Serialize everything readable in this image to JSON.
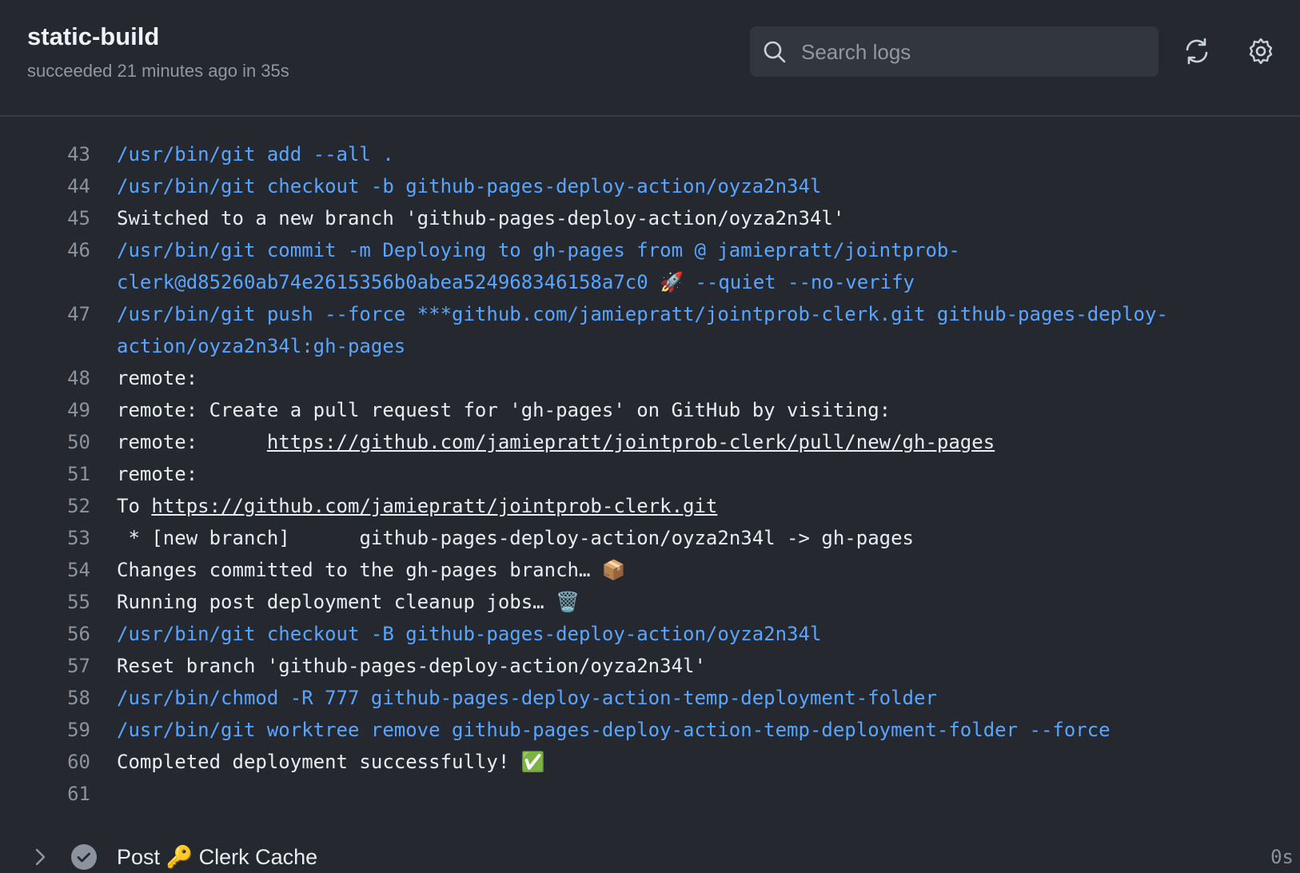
{
  "header": {
    "title": "static-build",
    "subtitle": "succeeded 21 minutes ago in 35s",
    "search_placeholder": "Search logs",
    "search_value": ""
  },
  "colors": {
    "background": "#25282e",
    "command": "#58a6ff",
    "text": "#e6edf3",
    "line_number": "#8b949e"
  },
  "log": [
    {
      "n": "43",
      "type": "cmd",
      "text": "/usr/bin/git add --all ."
    },
    {
      "n": "44",
      "type": "cmd",
      "text": "/usr/bin/git checkout -b github-pages-deploy-action/oyza2n34l"
    },
    {
      "n": "45",
      "type": "out",
      "text": "Switched to a new branch 'github-pages-deploy-action/oyza2n34l'"
    },
    {
      "n": "46",
      "type": "cmd",
      "text": "/usr/bin/git commit -m Deploying to gh-pages from @ jamiepratt/jointprob-clerk@d85260ab74e2615356b0abea524968346158a7c0 🚀 --quiet --no-verify"
    },
    {
      "n": "47",
      "type": "cmd",
      "text": "/usr/bin/git push --force ***github.com/jamiepratt/jointprob-clerk.git github-pages-deploy-action/oyza2n34l:gh-pages"
    },
    {
      "n": "48",
      "type": "out",
      "text": "remote: "
    },
    {
      "n": "49",
      "type": "out",
      "text": "remote: Create a pull request for 'gh-pages' on GitHub by visiting:        "
    },
    {
      "n": "50",
      "type": "out",
      "text": "remote:      ",
      "link": "https://github.com/jamiepratt/jointprob-clerk/pull/new/gh-pages"
    },
    {
      "n": "51",
      "type": "out",
      "text": "remote: "
    },
    {
      "n": "52",
      "type": "out",
      "text": "To ",
      "link": "https://github.com/jamiepratt/jointprob-clerk.git"
    },
    {
      "n": "53",
      "type": "out",
      "text": " * [new branch]      github-pages-deploy-action/oyza2n34l -> gh-pages"
    },
    {
      "n": "54",
      "type": "out",
      "text": "Changes committed to the gh-pages branch… 📦"
    },
    {
      "n": "55",
      "type": "out",
      "text": "Running post deployment cleanup jobs… 🗑️"
    },
    {
      "n": "56",
      "type": "cmd",
      "text": "/usr/bin/git checkout -B github-pages-deploy-action/oyza2n34l"
    },
    {
      "n": "57",
      "type": "out",
      "text": "Reset branch 'github-pages-deploy-action/oyza2n34l'"
    },
    {
      "n": "58",
      "type": "cmd",
      "text": "/usr/bin/chmod -R 777 github-pages-deploy-action-temp-deployment-folder"
    },
    {
      "n": "59",
      "type": "cmd",
      "text": "/usr/bin/git worktree remove github-pages-deploy-action-temp-deployment-folder --force"
    },
    {
      "n": "60",
      "type": "out",
      "text": "Completed deployment successfully! ✅"
    },
    {
      "n": "61",
      "type": "out",
      "text": ""
    }
  ],
  "step": {
    "label": "Post 🔑 Clerk Cache",
    "duration": "0s",
    "status": "success",
    "expand_icon": "chevron-right-icon"
  }
}
